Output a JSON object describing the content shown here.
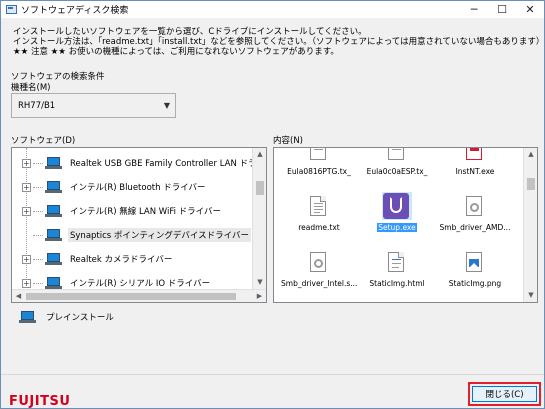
{
  "window": {
    "title": "ソフトウェアディスク検索",
    "minimize": "─",
    "maximize": "☐",
    "close": "✕"
  },
  "instructions": [
    "インストールしたいソフトウェアを一覧から選び、Cドライブにインストールしてください。",
    "インストール方法は、「readme.txt」「install.txt」などを参照してください。（ソフトウェアによっては用意されていない場合もあります）",
    "★★ 注意 ★★ お使いの機種によっては、ご利用になれないソフトウェアがあります。"
  ],
  "search": {
    "section_label": "ソフトウェアの検索条件",
    "model_label": "機種名(M)",
    "model_value": "RH77/B1"
  },
  "software": {
    "label": "ソフトウェア(D)",
    "items": [
      {
        "label": "Realtek USB GBE Family Controller LAN ドライバ",
        "expandable": true
      },
      {
        "label": "インテル(R) Bluetooth ドライバー",
        "expandable": true
      },
      {
        "label": "インテル(R) 無線 LAN WiFi ドライバー",
        "expandable": true
      },
      {
        "label": "Synaptics ポインティングデバイスドライバー",
        "expandable": false,
        "selected": true
      },
      {
        "label": "Realtek カメラドライバー",
        "expandable": true
      },
      {
        "label": "インテル(R) シリアル IO ドライバー",
        "expandable": true
      }
    ]
  },
  "contents": {
    "label": "内容(N)",
    "files": [
      {
        "name": "Eula0816PTG.tx_",
        "icon": "doc-icon"
      },
      {
        "name": "Eula0c0aESP.tx_",
        "icon": "doc-icon"
      },
      {
        "name": "InstNT.exe",
        "icon": "installer-icon"
      },
      {
        "name": "readme.txt",
        "icon": "text-file-icon"
      },
      {
        "name": "Setup.exe",
        "icon": "setup-icon",
        "selected": true
      },
      {
        "name": "Smb_driver_AMD...",
        "icon": "gear-file-icon"
      },
      {
        "name": "Smb_driver_Intel.s...",
        "icon": "gear-file-icon"
      },
      {
        "name": "StaticImg.html",
        "icon": "html-file-icon"
      },
      {
        "name": "StaticImg.png",
        "icon": "image-file-icon"
      }
    ]
  },
  "uninstall_label": "プレインストール",
  "logo": "FUJITSU",
  "close_button": "閉じる(C)",
  "colors": {
    "accent": "#0078d7",
    "logo": "#d5001c",
    "highlight": "#e0202a",
    "selection": "#3399ff"
  }
}
